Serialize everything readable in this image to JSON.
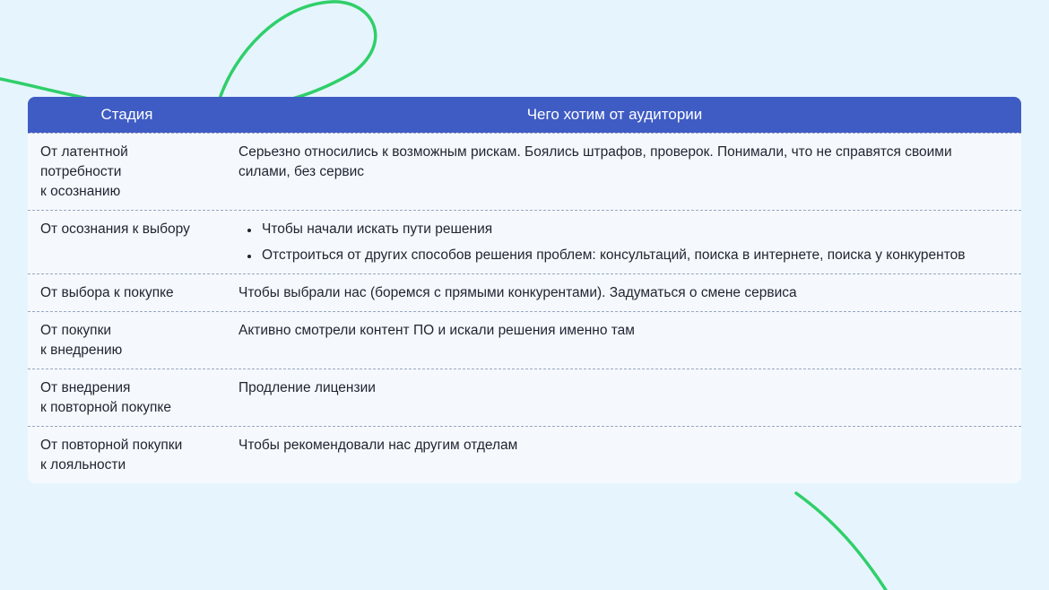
{
  "colors": {
    "background": "#e6f4fd",
    "header": "#3f5cc4",
    "accent_line": "#2fcf6a",
    "divider": "#9aa6c2"
  },
  "table": {
    "header": {
      "stage": "Стадия",
      "goal": "Чего хотим от аудитории"
    },
    "rows": [
      {
        "stage": "От латентной\nпотребности\nк осознанию",
        "goal": "Серьезно относились к возможным рискам. Боялись штрафов, проверок. Понимали, что не справятся своими силами, без сервис"
      },
      {
        "stage": "От осознания к выбору",
        "bullets": [
          "Чтобы начали искать пути решения",
          "Отстроиться от других способов решения проблем: консультаций, поиска в интернете, поиска у конкурентов"
        ]
      },
      {
        "stage": "От выбора к покупке",
        "goal": "Чтобы выбрали нас (боремся с прямыми конкурентами). Задуматься о смене сервиса"
      },
      {
        "stage": "От покупки\nк внедрению",
        "goal": "Активно смотрели контент ПО и искали решения именно там"
      },
      {
        "stage": "От внедрения\nк повторной покупке",
        "goal": "Продление лицензии"
      },
      {
        "stage": "От повторной покупки\nк лояльности",
        "goal": "Чтобы рекомендовали нас другим отделам"
      }
    ]
  }
}
